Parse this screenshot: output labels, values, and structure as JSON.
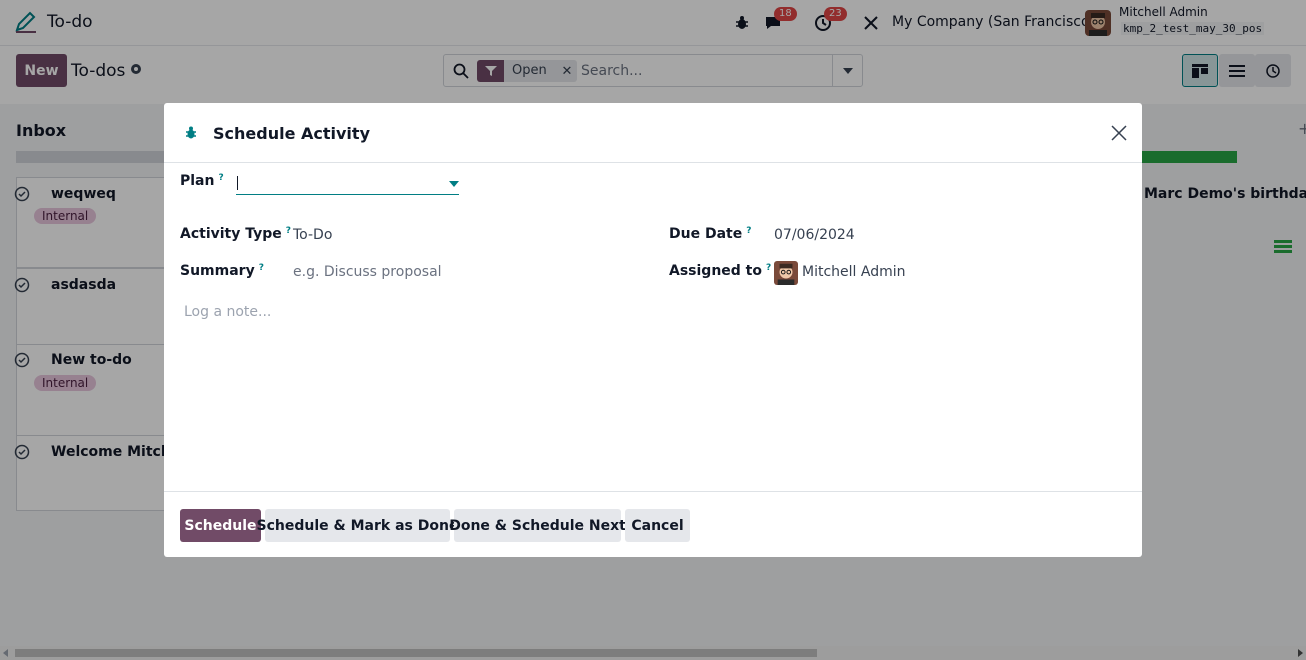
{
  "navbar": {
    "app_name": "To-do",
    "messages_badge": "18",
    "activities_badge": "23",
    "company": "My Company (San Francisco)",
    "user_name": "Mitchell Admin",
    "db_name": "kmp_2_test_may_30_pos"
  },
  "control": {
    "new_label": "New",
    "title": "To-dos",
    "search": {
      "facet_label": "Open",
      "placeholder": "Search..."
    }
  },
  "kanban": {
    "column_title": "Inbox",
    "cards": [
      {
        "title": "weqweq",
        "tag": "Internal"
      },
      {
        "title": "asdasda",
        "tag": ""
      },
      {
        "title": "New to-do",
        "tag": "Internal"
      },
      {
        "title": "Welcome Mitche",
        "tag": ""
      }
    ],
    "right_card_title": "Marc Demo's birthday"
  },
  "dialog": {
    "title": "Schedule Activity",
    "plan_label": "Plan",
    "plan_value": "",
    "activity_type_label": "Activity Type",
    "activity_type_value": "To-Do",
    "summary_label": "Summary",
    "summary_placeholder": "e.g. Discuss proposal",
    "due_date_label": "Due Date",
    "due_date_value": "07/06/2024",
    "assigned_label": "Assigned to",
    "assigned_value": "Mitchell Admin",
    "help_mark": "?",
    "note_placeholder": "Log a note...",
    "buttons": {
      "schedule": "Schedule",
      "schedule_done": "Schedule & Mark as Done",
      "done_next": "Done & Schedule Next",
      "cancel": "Cancel"
    }
  },
  "colors": {
    "primary": "#714b67",
    "teal": "#017e84",
    "badge_red": "#e04646",
    "progress_green": "#28a745"
  },
  "icons": [
    "pencil-logo-icon",
    "bug-icon",
    "chat-icon",
    "clock-icon",
    "tools-icon",
    "search-icon",
    "filter-icon",
    "gear-icon",
    "kanban-icon",
    "list-icon",
    "activity-icon",
    "close-icon",
    "check-circle-icon",
    "caret-down-icon"
  ]
}
